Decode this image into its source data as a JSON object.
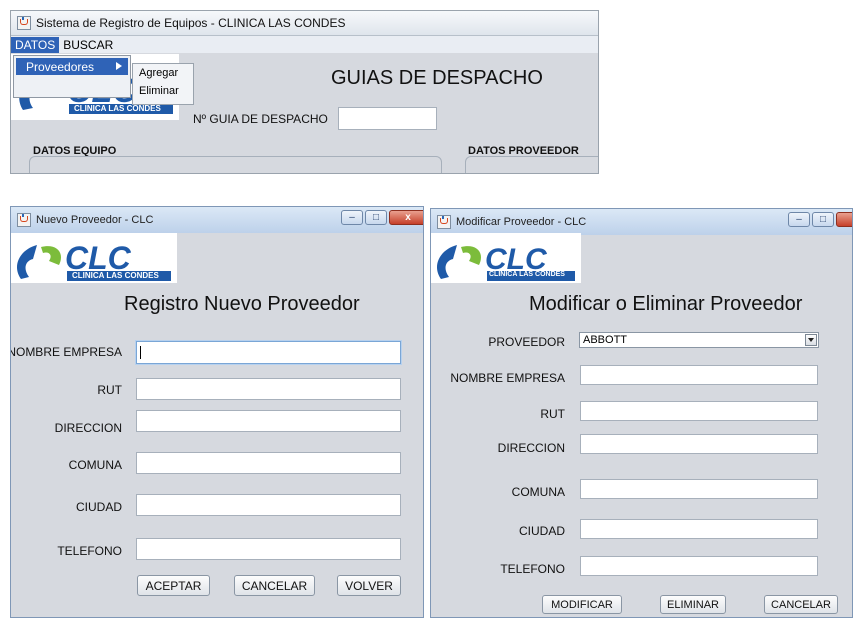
{
  "main_window": {
    "title": "Sistema de Registro de Equipos - CLINICA LAS CONDES",
    "menu": [
      "DATOS",
      "BUSCAR"
    ],
    "dropdown_item": "Proveedores",
    "submenu": [
      "Agregar",
      "Eliminar"
    ],
    "heading": "GUIAS DE DESPACHO",
    "guia_label": "Nº GUIA DE DESPACHO",
    "guia_value": "",
    "group_equipo": "DATOS EQUIPO",
    "group_proveedor": "DATOS PROVEEDOR"
  },
  "logo": {
    "text": "CLC",
    "subtext": "CLINICA LAS CONDES",
    "colors": {
      "blue": "#1f5aa8",
      "green": "#7cbc3b"
    }
  },
  "new_dialog": {
    "title": "Nuevo Proveedor - CLC",
    "heading": "Registro Nuevo Proveedor",
    "fields": [
      {
        "label": "NOMBRE EMPRESA",
        "value": ""
      },
      {
        "label": "RUT",
        "value": ""
      },
      {
        "label": "DIRECCION",
        "value": ""
      },
      {
        "label": "COMUNA",
        "value": ""
      },
      {
        "label": "CIUDAD",
        "value": ""
      },
      {
        "label": "TELEFONO",
        "value": ""
      }
    ],
    "buttons": {
      "accept": "ACEPTAR",
      "cancel": "CANCELAR",
      "back": "VOLVER"
    }
  },
  "edit_dialog": {
    "title": "Modificar Proveedor - CLC",
    "heading": "Modificar o Eliminar Proveedor",
    "proveedor_label": "PROVEEDOR",
    "proveedor_selected": "ABBOTT",
    "fields": [
      {
        "label": "NOMBRE EMPRESA",
        "value": ""
      },
      {
        "label": "RUT",
        "value": ""
      },
      {
        "label": "DIRECCION",
        "value": ""
      },
      {
        "label": "COMUNA",
        "value": ""
      },
      {
        "label": "CIUDAD",
        "value": ""
      },
      {
        "label": "TELEFONO",
        "value": ""
      }
    ],
    "buttons": {
      "modify": "MODIFICAR",
      "delete": "ELIMINAR",
      "cancel": "CANCELAR"
    }
  },
  "window_controls": {
    "minimize": "–",
    "maximize": "□",
    "close": "x"
  }
}
